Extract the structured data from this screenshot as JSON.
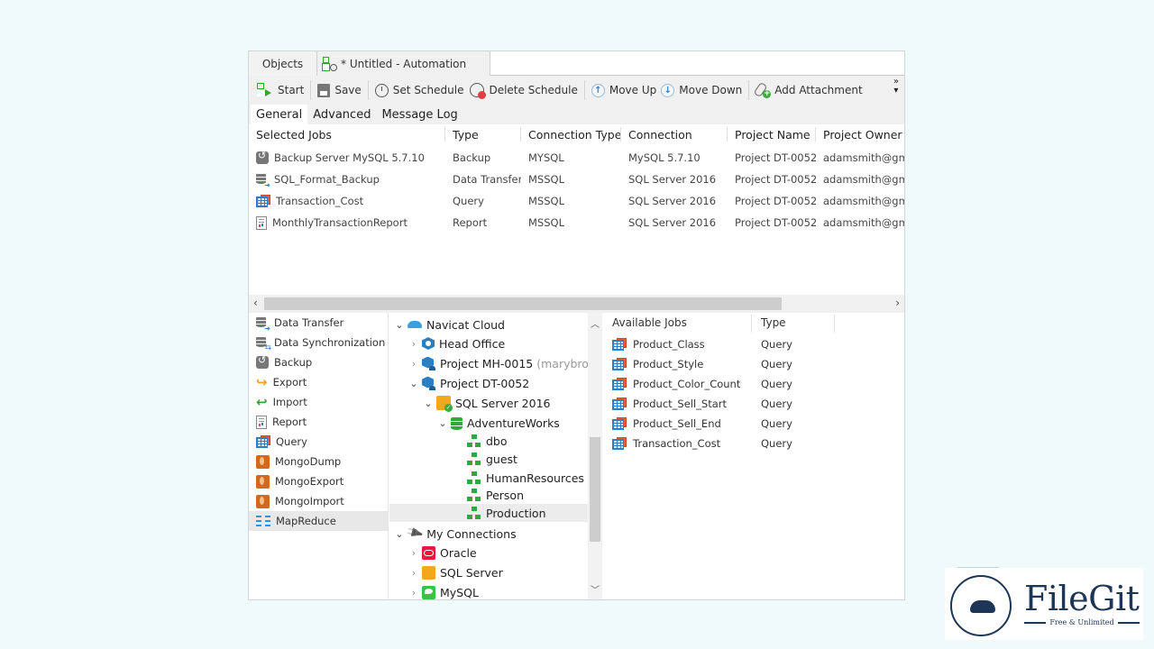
{
  "tabs": [
    {
      "label": "Objects",
      "active": false
    },
    {
      "label": "* Untitled - Automation",
      "active": true,
      "icon": "automation-icon"
    }
  ],
  "toolbar": {
    "start": "Start",
    "save": "Save",
    "set_schedule": "Set Schedule",
    "delete_schedule": "Delete Schedule",
    "move_up": "Move Up",
    "move_down": "Move Down",
    "add_attachment": "Add Attachment",
    "more": "»"
  },
  "subtabs": [
    "General",
    "Advanced",
    "Message Log"
  ],
  "selected_jobs": {
    "columns": [
      "Selected Jobs",
      "Type",
      "Connection Type",
      "Connection",
      "Project Name",
      "Project Owner N"
    ],
    "rows": [
      {
        "icon": "backup-icon",
        "name": "Backup Server MySQL 5.7.10",
        "type": "Backup",
        "conn_type": "MYSQL",
        "connection": "MySQL 5.7.10",
        "project": "Project DT-0052",
        "owner": "adamsmith@gma"
      },
      {
        "icon": "data-transfer-icon",
        "name": "SQL_Format_Backup",
        "type": "Data Transfer",
        "conn_type": "MSSQL",
        "connection": "SQL Server 2016",
        "project": "Project DT-0052",
        "owner": "adamsmith@gma"
      },
      {
        "icon": "query-icon",
        "name": "Transaction_Cost",
        "type": "Query",
        "conn_type": "MSSQL",
        "connection": "SQL Server 2016",
        "project": "Project DT-0052",
        "owner": "adamsmith@gma"
      },
      {
        "icon": "report-icon",
        "name": "MonthlyTransactionReport",
        "type": "Report",
        "conn_type": "MSSQL",
        "connection": "SQL Server 2016",
        "project": "Project DT-0052",
        "owner": "adamsmith@gma"
      }
    ]
  },
  "job_types": [
    {
      "label": "Data Transfer",
      "icon": "data-transfer-icon"
    },
    {
      "label": "Data Synchronization",
      "icon": "data-sync-icon"
    },
    {
      "label": "Backup",
      "icon": "backup-icon"
    },
    {
      "label": "Export",
      "icon": "export-icon"
    },
    {
      "label": "Import",
      "icon": "import-icon"
    },
    {
      "label": "Report",
      "icon": "report-icon"
    },
    {
      "label": "Query",
      "icon": "query-icon"
    },
    {
      "label": "MongoDump",
      "icon": "mongodump-icon"
    },
    {
      "label": "MongoExport",
      "icon": "mongoexport-icon"
    },
    {
      "label": "MongoImport",
      "icon": "mongoimport-icon"
    },
    {
      "label": "MapReduce",
      "icon": "mapreduce-icon",
      "selected": true
    }
  ],
  "tree": {
    "navicat_cloud": "Navicat Cloud",
    "head_office": "Head Office",
    "project_mh": "Project MH-0015",
    "project_mh_owner": "(marybrow",
    "project_dt": "Project DT-0052",
    "sql_server_2016": "SQL Server 2016",
    "adventureworks": "AdventureWorks",
    "schemas": [
      "dbo",
      "guest",
      "HumanResources",
      "Person",
      "Production"
    ],
    "selected_schema": "Production",
    "my_connections": "My Connections",
    "connections": [
      "Oracle",
      "SQL Server",
      "MySQL"
    ]
  },
  "available_jobs": {
    "columns": [
      "Available Jobs",
      "Type"
    ],
    "rows": [
      {
        "name": "Product_Class",
        "type": "Query"
      },
      {
        "name": "Product_Style",
        "type": "Query"
      },
      {
        "name": "Product_Color_Count",
        "type": "Query"
      },
      {
        "name": "Product_Sell_Start",
        "type": "Query"
      },
      {
        "name": "Product_Sell_End",
        "type": "Query"
      },
      {
        "name": "Transaction_Cost",
        "type": "Query"
      }
    ]
  },
  "watermark": {
    "brand": "FileGit",
    "tagline": "Free & Unlimited"
  },
  "colors": {
    "accent_blue": "#2f7dc2",
    "green": "#2eaa3c",
    "background": "#f0fafb",
    "brand": "#1d3557"
  }
}
